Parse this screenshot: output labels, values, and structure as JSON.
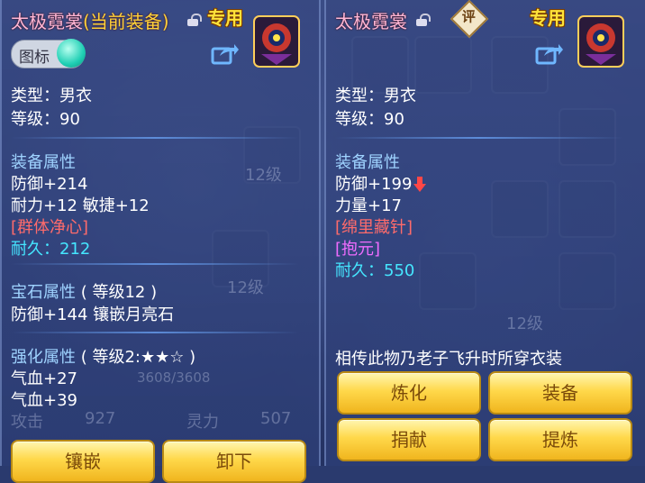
{
  "left": {
    "title_name": "太极霓裳",
    "title_status": "(当前装备)",
    "exclusive_badge": "专用",
    "icon_toggle_label": "图标",
    "type": "类型：男衣",
    "level": "等级：90",
    "equip_attr_header": "装备属性",
    "defense": "防御+214",
    "stats": "耐力+12 敏捷+12",
    "special_skill": "[群体净心]",
    "durability": "耐久：212",
    "gem_header": "宝石属性",
    "gem_level": "( 等级12 )",
    "gem_effect": "防御+144 镶嵌月亮石",
    "enhance_header": "强化属性",
    "enhance_level": "( 等级2:★★☆ )",
    "enhance_hp1": "气血+27",
    "enhance_hp2": "气血+39",
    "buttons": {
      "inlay": "镶嵌",
      "unequip": "卸下"
    }
  },
  "right": {
    "title_name": "太极霓裳",
    "rating_label": "评",
    "exclusive_badge": "专用",
    "type": "类型：男衣",
    "level": "等级：90",
    "equip_attr_header": "装备属性",
    "defense": "防御+199",
    "stats": "力量+17",
    "special_skill": "[绵里藏针]",
    "special_effect": "[抱元]",
    "durability": "耐久：550",
    "description": "相传此物乃老子飞升时所穿衣装",
    "buttons": {
      "refine": "炼化",
      "equip": "装备",
      "donate": "捐献",
      "extract": "提炼"
    }
  },
  "background": {
    "attack_label": "攻击",
    "attack_value": "927",
    "spirit_label": "灵力",
    "spirit_value": "507",
    "hp_bar_text": "3608/3608",
    "slot_level_1": "12级",
    "slot_level_2": "12级",
    "slot_level_3": "12级"
  },
  "colors": {
    "title": "#ffb7d6",
    "current_status": "#ffd23a",
    "section_header": "#9fd3ff",
    "skill_red": "#ff6b6b",
    "durability_cyan": "#45e6ff",
    "effect_magenta": "#f06cff",
    "button_gold": "#ffd84a"
  }
}
